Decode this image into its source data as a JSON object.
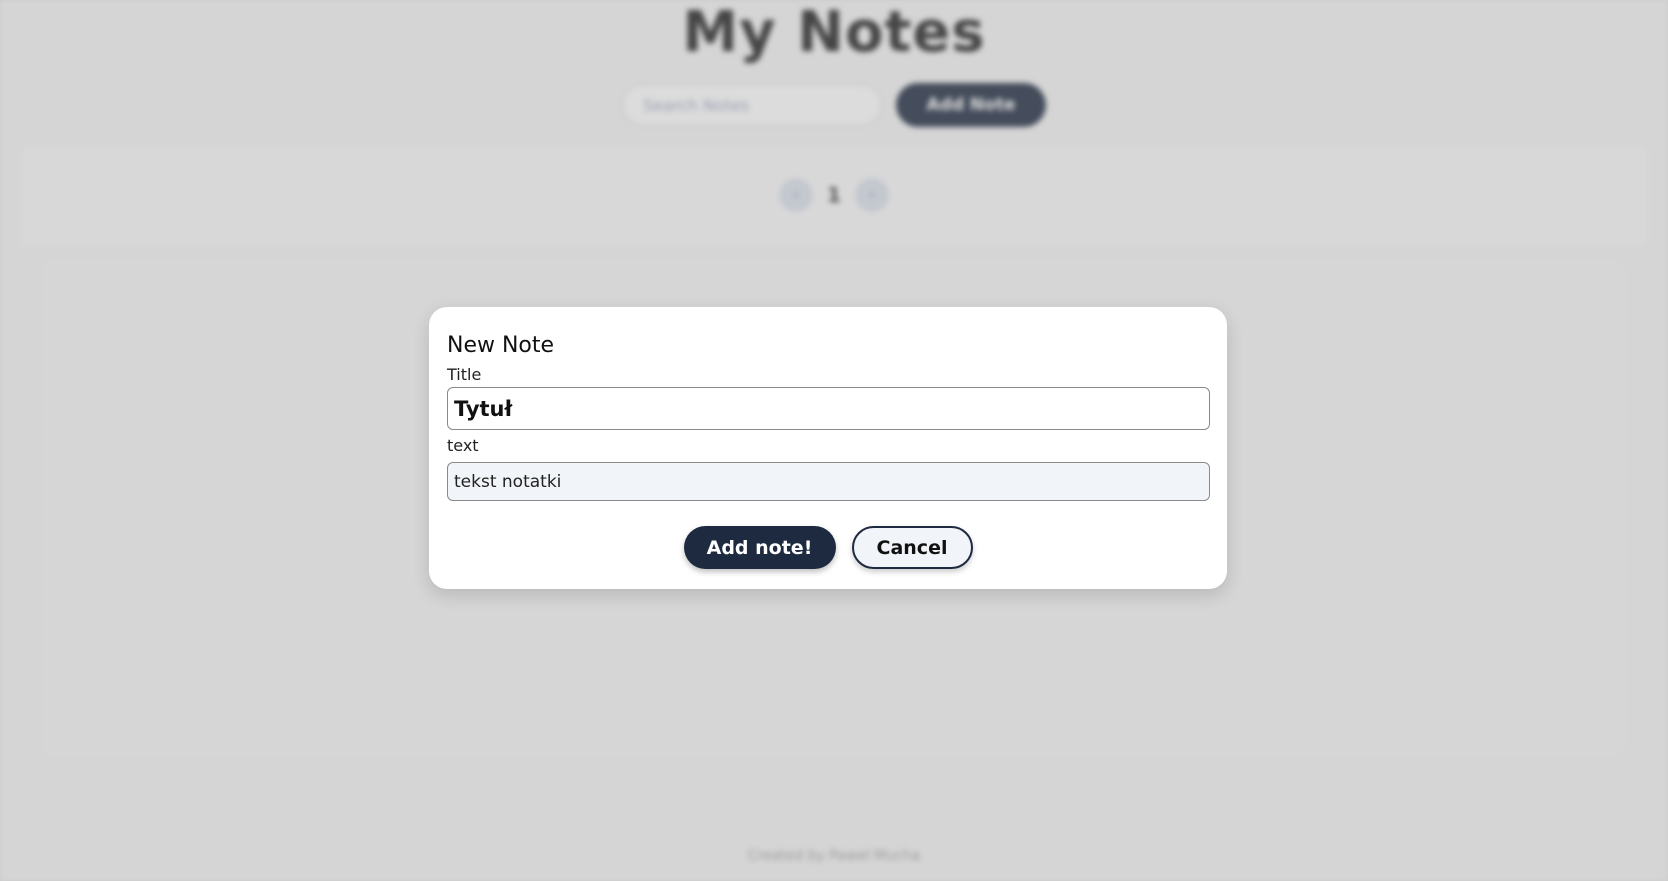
{
  "page": {
    "title": "My Notes",
    "search_placeholder": "Search Notes",
    "add_note_label": "Add Note",
    "pagination": {
      "prev_icon": "‹",
      "current_page": "1",
      "next_icon": "›"
    },
    "footer": "Created by Paweł Mucha"
  },
  "modal": {
    "heading": "New Note",
    "title_label": "Title",
    "title_value": "Tytuł",
    "text_label": "text",
    "text_value": "tekst notatki",
    "submit_label": "Add note!",
    "cancel_label": "Cancel"
  },
  "colors": {
    "primary": "#1e2a40",
    "overlay": "rgba(150,150,150,0.33)",
    "modal_bg": "#ffffff"
  }
}
